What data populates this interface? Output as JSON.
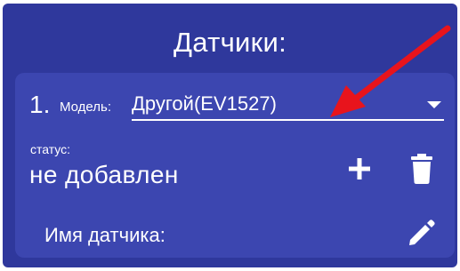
{
  "header": {
    "title": "Датчики:"
  },
  "sensor_card": {
    "number": "1.",
    "model_label": "Модель:",
    "model_value": "Другой(EV1527)",
    "status_label": "статус:",
    "status_value": "не добавлен",
    "sensor_name_label": "Имя датчика:"
  },
  "icons": {
    "add": "plus-icon",
    "delete": "trash-icon",
    "edit": "pencil-icon",
    "dropdown": "chevron-down-icon",
    "annotation": "red-arrow-icon"
  },
  "colors": {
    "background": "#2f389c",
    "card": "#3c46b0",
    "text": "#ffffff",
    "annotation_arrow": "#e8141c"
  }
}
